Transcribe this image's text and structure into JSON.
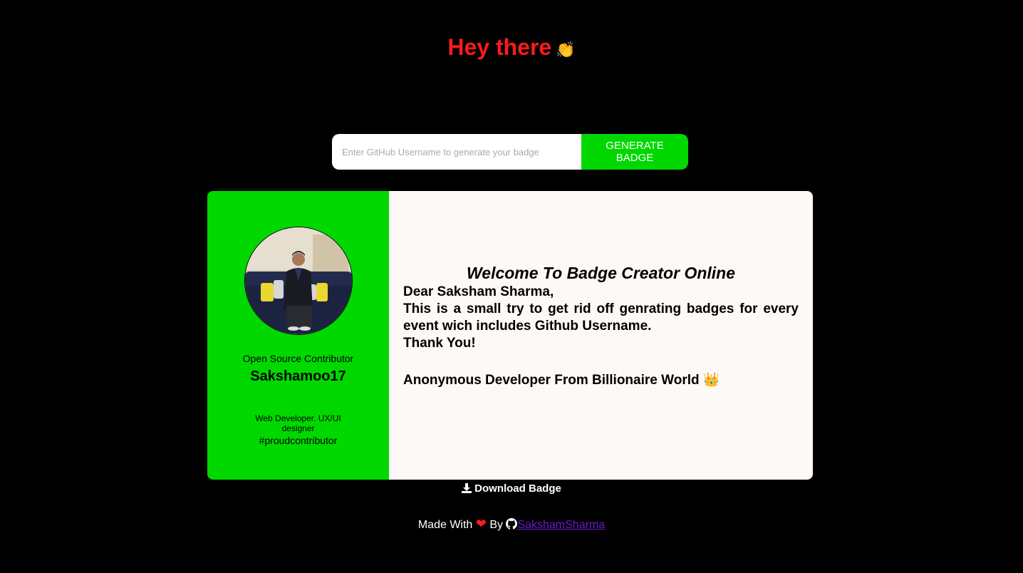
{
  "header": {
    "greeting": "Hey there",
    "greeting_emoji": "👏"
  },
  "search": {
    "placeholder": "Enter GitHub Username to generate your badge",
    "value": "",
    "button_label": "GENERATE BADGE"
  },
  "badge": {
    "role_title": "Open Source Contributor",
    "username": "Sakshamoo17",
    "bio": "Web Developer. UX/UI designer",
    "hashtag": "#proudcontributor",
    "welcome": "Welcome To Badge Creator Online",
    "salutation": "Dear Saksham Sharma,",
    "message": "This is a small try to get rid off genrating badges for every event wich includes Github Username.",
    "thanks": "Thank You!",
    "signoff": "Anonymous Developer From Billionaire World",
    "signoff_emoji": "👑"
  },
  "actions": {
    "download_label": "Download Badge"
  },
  "footer": {
    "made_with": "Made With",
    "heart": "❤",
    "by": "By",
    "author_link": "SakshamSharma"
  },
  "colors": {
    "greeting": "#ff1a1a",
    "accent_green": "#00d800",
    "card_background": "#fdf9f7",
    "link": "#6a1bcc"
  }
}
